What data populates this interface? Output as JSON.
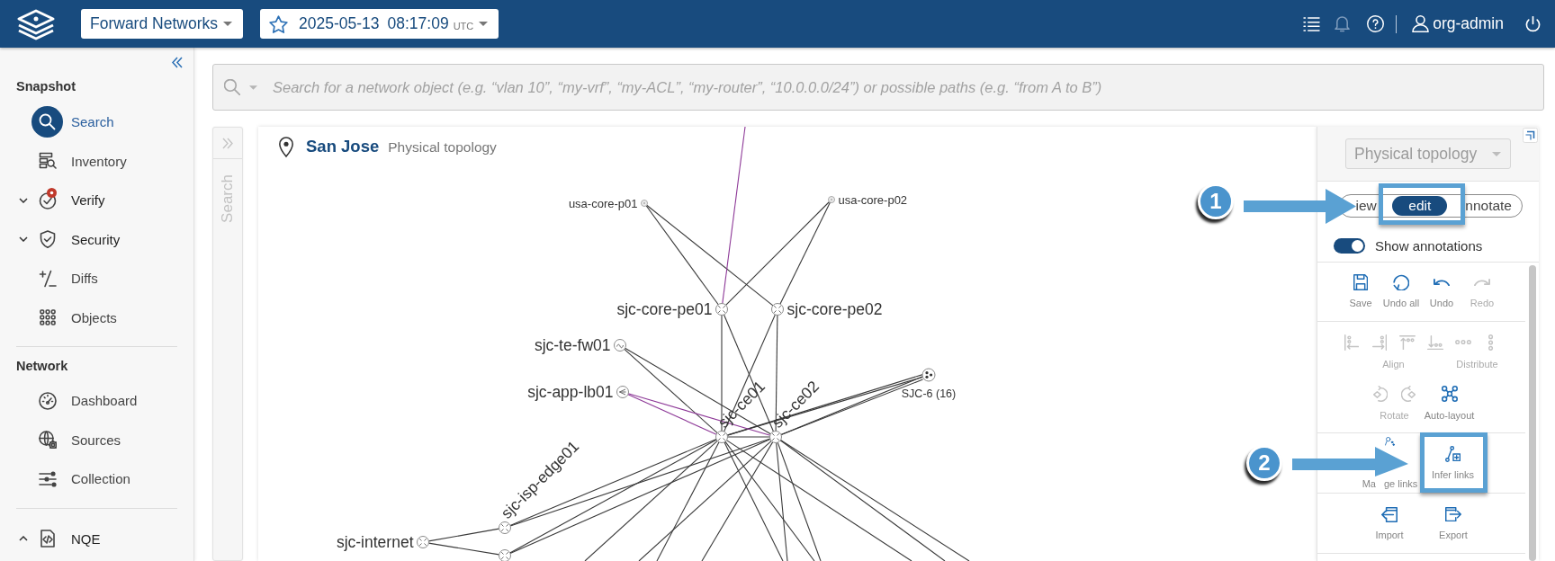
{
  "header": {
    "org_select": {
      "value": "Forward Networks"
    },
    "snapshot_select": {
      "date": "2025-05-13",
      "time": "08:17:09",
      "zone": "UTC"
    },
    "actions": [
      {
        "kind": "list",
        "disabled": false
      },
      {
        "kind": "bell",
        "disabled": true
      },
      {
        "kind": "help",
        "disabled": false
      }
    ],
    "user": "org-admin"
  },
  "sidebar": {
    "sections": [
      {
        "title": "Snapshot",
        "items": [
          {
            "label": "Search",
            "kind": "page",
            "selected": true,
            "alert": false
          },
          {
            "label": "Inventory",
            "kind": "page",
            "selected": false,
            "alert": false
          },
          {
            "label": "Verify",
            "kind": "group",
            "expanded": false,
            "selected": false,
            "alert": true
          },
          {
            "label": "Security",
            "kind": "group",
            "expanded": false,
            "selected": false,
            "alert": false
          },
          {
            "label": "Diffs",
            "kind": "page",
            "selected": false,
            "alert": false
          },
          {
            "label": "Objects",
            "kind": "page",
            "selected": false,
            "alert": false
          }
        ]
      },
      {
        "title": "Network",
        "items": [
          {
            "label": "Dashboard",
            "kind": "page",
            "selected": false,
            "alert": false
          },
          {
            "label": "Sources",
            "kind": "page",
            "selected": false,
            "alert": false
          },
          {
            "label": "Collection",
            "kind": "page",
            "selected": false,
            "alert": false
          }
        ]
      },
      {
        "items": [
          {
            "label": "NQE",
            "kind": "group",
            "expanded": true,
            "selected": false,
            "alert": false
          }
        ]
      }
    ]
  },
  "search": {
    "placeholder": "Search for a network object (e.g. “vlan 10”, “my-vrf”, “my-ACL”, “my-router”, “10.0.0.0/24”) or possible paths (e.g. “from A to B”)"
  },
  "search_rail": {
    "label": "Search"
  },
  "topology": {
    "site": "San Jose",
    "view": "Physical topology",
    "nodes": [
      {
        "label": "usa-core-p01",
        "kind": "device"
      },
      {
        "label": "usa-core-p02",
        "kind": "device"
      },
      {
        "label": "sjc-core-pe01",
        "kind": "router"
      },
      {
        "label": "sjc-core-pe02",
        "kind": "router"
      },
      {
        "label": "sjc-te-fw01",
        "kind": "firewall"
      },
      {
        "label": "sjc-app-lb01",
        "kind": "load-balancer"
      },
      {
        "label": "sjc-ce01",
        "kind": "router"
      },
      {
        "label": "sjc-ce02",
        "kind": "router"
      },
      {
        "label": "SJC-6 (16)",
        "kind": "group"
      },
      {
        "label": "sjc-isp-edge01",
        "kind": "router"
      },
      {
        "kind": "router"
      },
      {
        "label": "sjc-internet",
        "kind": "router"
      }
    ]
  },
  "panel": {
    "layer_select": {
      "value": "Physical topology",
      "disabled": true
    },
    "modes": [
      {
        "label": "iew",
        "selected": false
      },
      {
        "label": "edit",
        "selected": true
      },
      {
        "label": "nnotate",
        "selected": false
      }
    ],
    "show_annotations": {
      "label": "Show annotations",
      "on": true
    },
    "tool_sections": [
      {
        "tools": [
          {
            "label": "Save",
            "disabled": false
          },
          {
            "label": "Undo all",
            "disabled": false
          },
          {
            "label": "Undo",
            "disabled": false
          },
          {
            "label": "Redo",
            "disabled": true
          }
        ]
      },
      {
        "tools": [
          {
            "label": "Align",
            "disabled": true
          },
          {
            "label": "Distribute",
            "disabled": true
          },
          {
            "label": "Rotate",
            "disabled": true
          },
          {
            "label": "Auto-layout",
            "disabled": false
          }
        ]
      },
      {
        "tools": [
          {
            "label_parts": [
              "Ma",
              "ge links"
            ],
            "disabled": false
          },
          {
            "label": "Infer links",
            "disabled": false
          }
        ]
      },
      {
        "tools": [
          {
            "label": "Import",
            "disabled": false
          },
          {
            "label": "Export",
            "disabled": false
          }
        ]
      }
    ]
  },
  "callouts": [
    {
      "number": "1"
    },
    {
      "number": "2"
    }
  ]
}
